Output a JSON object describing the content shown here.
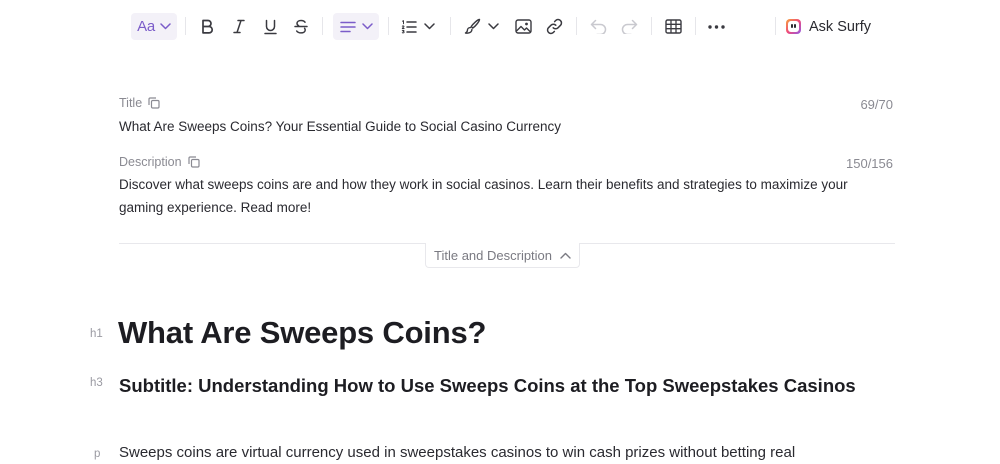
{
  "toolbar": {
    "text_style_label": "Aa",
    "ask_surfy_label": "Ask Surfy"
  },
  "meta": {
    "title_label": "Title",
    "title_count": "69/70",
    "title_value": "What Are Sweeps Coins? Your Essential Guide to Social Casino Currency",
    "description_label": "Description",
    "description_count": "150/156",
    "description_value": "Discover what sweeps coins are and how they work in social casinos. Learn their benefits and strategies to maximize your gaming experience. Read more!",
    "collapse_label": "Title and Description"
  },
  "content": {
    "h1_tag": "h1",
    "h1_text": "What Are Sweeps Coins?",
    "h3_tag": "h3",
    "h3_text": "Subtitle: Understanding How to Use Sweeps Coins at the Top Sweepstakes Casinos",
    "p_tag": "p",
    "p_text": "Sweeps coins are virtual currency used in sweepstakes casinos to win cash prizes without betting real"
  },
  "colors": {
    "accent": "#7b5cc9",
    "text": "#1d1d22",
    "muted": "#8a8a92"
  }
}
